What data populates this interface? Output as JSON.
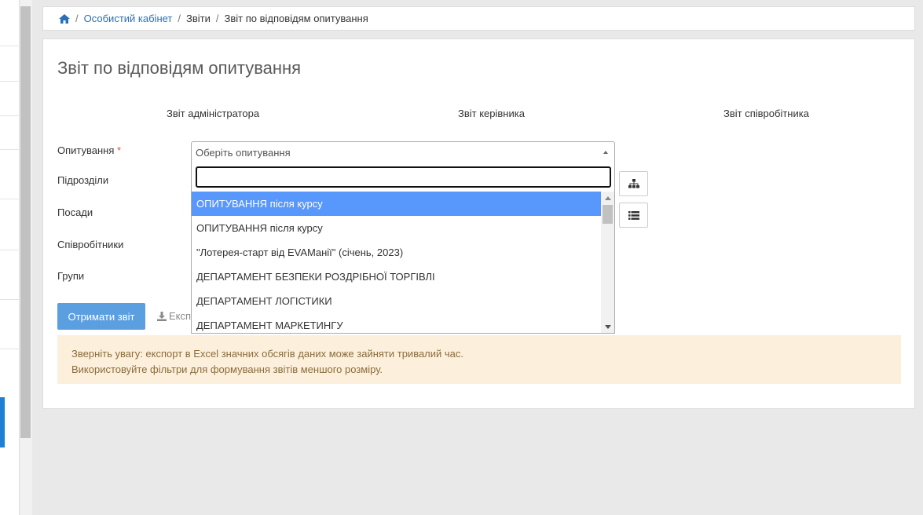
{
  "breadcrumb": {
    "home_icon": "home-icon",
    "items": [
      "Особистий кабінет",
      "Звіти",
      "Звіт по відповідям опитування"
    ],
    "separator": "/"
  },
  "page": {
    "title": "Звіт по відповідям опитування",
    "tabs": [
      "Звіт адміністратора",
      "Звіт керівника",
      "Звіт співробітника"
    ]
  },
  "form": {
    "labels": {
      "survey": "Опитування",
      "survey_required": "*",
      "departments": "Підрозділи",
      "positions": "Посади",
      "employees": "Співробітники",
      "groups": "Групи"
    },
    "survey_placeholder": "Оберіть опитування",
    "org_button_icon": "sitemap-icon",
    "list_button_icon": "list-icon"
  },
  "dropdown": {
    "search_value": "",
    "options": [
      "ОПИТУВАННЯ після курсу",
      "ОПИТУВАННЯ після курсу",
      "\"Лотерея-старт від EVAMанії\" (січень, 2023)",
      "ДЕПАРТАМЕНТ БЕЗПЕКИ РОЗДРІБНОЇ ТОРГІВЛІ",
      "ДЕПАРТАМЕНТ ЛОГІСТИКИ",
      "ДЕПАРТАМЕНТ МАРКЕТИНГУ"
    ],
    "highlighted_index": 0
  },
  "actions": {
    "get_report": "Отримати звіт",
    "export": "Експ",
    "export_icon": "download-icon"
  },
  "alert": {
    "line1": "Зверніть увагу: експорт в Excel значних обсягів даних може зайняти тривалий час.",
    "line2": "Використовуйте фільтри для формування звітів меншого розміру."
  },
  "colors": {
    "primary": "#5b9fe0",
    "link": "#2a6fb8",
    "highlight": "#5897fb",
    "alert_bg": "#fcefdc",
    "alert_text": "#8a6d3b"
  }
}
